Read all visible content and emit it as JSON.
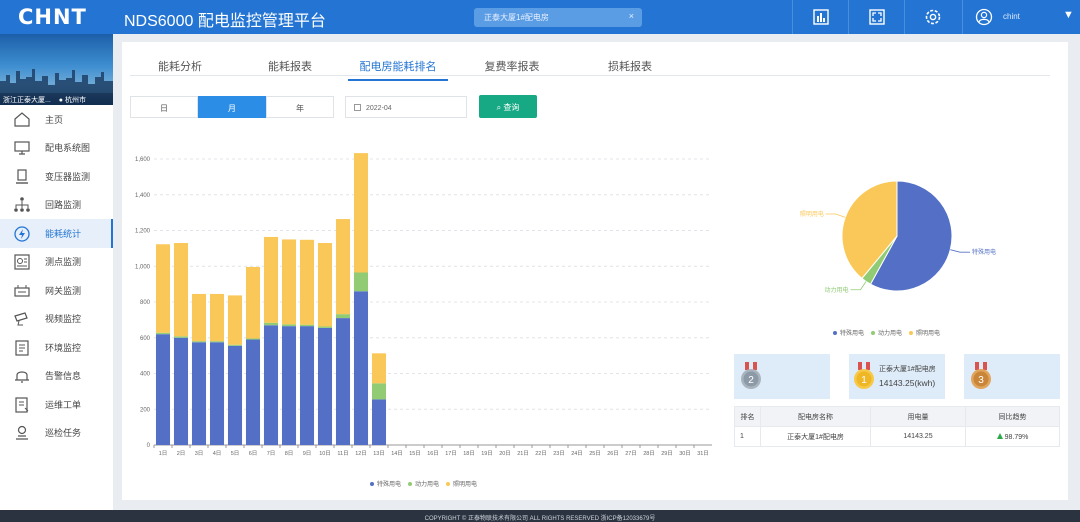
{
  "header": {
    "logo": "CHNT",
    "title": "NDS6000 配电监控管理平台",
    "site_select": "正泰大厦1#配电房",
    "site_clear": "×",
    "user": "chint",
    "caret": "▼"
  },
  "sidebar": {
    "banner_site": "浙江正泰大厦...",
    "banner_city": "杭州市",
    "items": [
      {
        "label": "主页",
        "icon": "home-icon"
      },
      {
        "label": "配电系统图",
        "icon": "monitor-icon"
      },
      {
        "label": "变压器监测",
        "icon": "transformer-icon"
      },
      {
        "label": "回路监测",
        "icon": "network-icon"
      },
      {
        "label": "能耗统计",
        "icon": "energy-icon"
      },
      {
        "label": "测点监测",
        "icon": "gauge-icon"
      },
      {
        "label": "网关监测",
        "icon": "gateway-icon"
      },
      {
        "label": "视频监控",
        "icon": "camera-icon"
      },
      {
        "label": "环境监控",
        "icon": "environment-icon"
      },
      {
        "label": "告警信息",
        "icon": "bell-icon"
      },
      {
        "label": "运维工单",
        "icon": "workorder-icon"
      },
      {
        "label": "巡检任务",
        "icon": "inspection-icon"
      }
    ],
    "active_index": 4
  },
  "tabs": [
    "能耗分析",
    "能耗报表",
    "配电房能耗排名",
    "复费率报表",
    "损耗报表"
  ],
  "active_tab": 2,
  "filters": {
    "day": "日",
    "month": "月",
    "year": "年",
    "date": "2022-04",
    "query": "查询"
  },
  "chart_data": [
    {
      "type": "bar",
      "stacked": true,
      "categories": [
        "1日",
        "2日",
        "3日",
        "4日",
        "5日",
        "6日",
        "7日",
        "8日",
        "9日",
        "10日",
        "11日",
        "12日",
        "13日",
        "14日",
        "15日",
        "16日",
        "17日",
        "18日",
        "19日",
        "20日",
        "21日",
        "22日",
        "23日",
        "24日",
        "25日",
        "26日",
        "27日",
        "28日",
        "29日",
        "30日",
        "31日"
      ],
      "yticks": [
        "0",
        "200",
        "400",
        "600",
        "800",
        "1,000",
        "1,200",
        "1,400",
        "1,600"
      ],
      "ylim": [
        0,
        1600
      ],
      "series": [
        {
          "name": "特殊用电",
          "color": "#5470c6",
          "values": [
            620,
            600,
            575,
            575,
            555,
            590,
            670,
            665,
            665,
            655,
            710,
            860,
            255,
            0,
            0,
            0,
            0,
            0,
            0,
            0,
            0,
            0,
            0,
            0,
            0,
            0,
            0,
            0,
            0,
            0,
            0
          ]
        },
        {
          "name": "动力用电",
          "color": "#91cc75",
          "values": [
            8,
            8,
            6,
            6,
            6,
            6,
            14,
            10,
            8,
            8,
            22,
            105,
            90,
            0,
            0,
            0,
            0,
            0,
            0,
            0,
            0,
            0,
            0,
            0,
            0,
            0,
            0,
            0,
            0,
            0,
            0
          ]
        },
        {
          "name": "照明用电",
          "color": "#fac858",
          "values": [
            495,
            522,
            264,
            264,
            276,
            400,
            480,
            475,
            475,
            467,
            532,
            668,
            168,
            0,
            0,
            0,
            0,
            0,
            0,
            0,
            0,
            0,
            0,
            0,
            0,
            0,
            0,
            0,
            0,
            0,
            0
          ]
        }
      ],
      "grid": true,
      "legend": "bottom"
    },
    {
      "type": "pie",
      "slices": [
        {
          "name": "特殊用电",
          "value": 58,
          "color": "#5470c6"
        },
        {
          "name": "动力用电",
          "value": 3,
          "color": "#91cc75"
        },
        {
          "name": "照明用电",
          "value": 39,
          "color": "#fac858"
        }
      ],
      "legend": "bottom"
    }
  ],
  "ranking": {
    "medals": [
      {
        "rank": "2",
        "name": "",
        "value": ""
      },
      {
        "rank": "1",
        "name": "正泰大厦1#配电房",
        "value": "14143.25(kwh)"
      },
      {
        "rank": "3",
        "name": "",
        "value": ""
      }
    ],
    "headers": [
      "排名",
      "配电房名称",
      "用电量",
      "同比趋势"
    ],
    "rows": [
      {
        "rank": "1",
        "name": "正泰大厦1#配电房",
        "usage": "14143.25",
        "trend": "98.79%"
      }
    ]
  },
  "footer": "COPYRIGHT © 正泰物联技术有限公司 ALL RIGHTS RESERVED 浙ICP备12033679号",
  "colors": {
    "primary": "#2475d3",
    "query": "#17a884",
    "trend_up": "#2aa84a"
  }
}
